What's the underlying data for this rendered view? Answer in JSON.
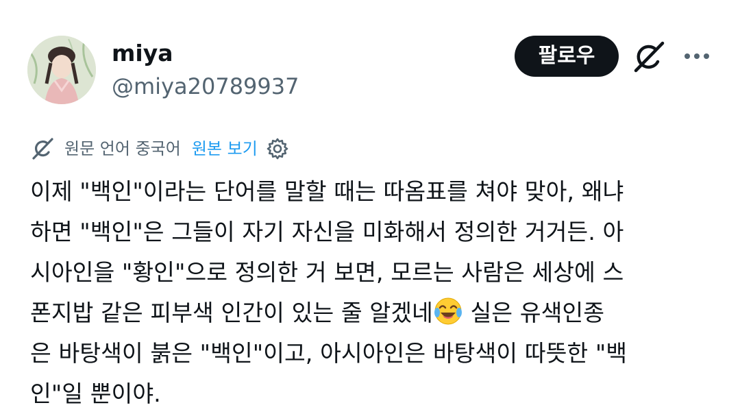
{
  "author": {
    "display_name": "miya",
    "handle": "@miya20789937",
    "avatar_icon": "avatar-image"
  },
  "actions": {
    "follow_label": "팔로우",
    "grok_icon": "grok-icon",
    "more_icon": "more-dots-icon"
  },
  "translation": {
    "label": "원문 언어 중국어",
    "show_original_label": "원본 보기",
    "translate_icon": "grok-icon",
    "settings_icon": "gear-icon"
  },
  "tweet": {
    "lines": [
      "이제 \"백인\"이라는 단어를 말할 때는 따옴표를 쳐야 맞아, 왜냐",
      "하면 \"백인\"은 그들이 자기 자신을 미화해서 정의한 거거든. 아",
      "시아인을 \"황인\"으로 정의한 거 보면, 모르는 사람은 세상에 스",
      "폰지밥 같은 피부색 인간이 있는 줄 알겠네",
      " 실은 유색인종",
      "은 바탕색이 붉은 \"백인\"이고, 아시아인은 바탕색이 따뜻한 \"백",
      "인\"일 뿐이야."
    ],
    "emoji_name": "face-with-tears-of-joy-icon"
  },
  "colors": {
    "text_primary": "#0f1419",
    "text_secondary": "#536471",
    "link": "#1d9bf0",
    "button_bg": "#0f1419",
    "button_text": "#ffffff"
  }
}
